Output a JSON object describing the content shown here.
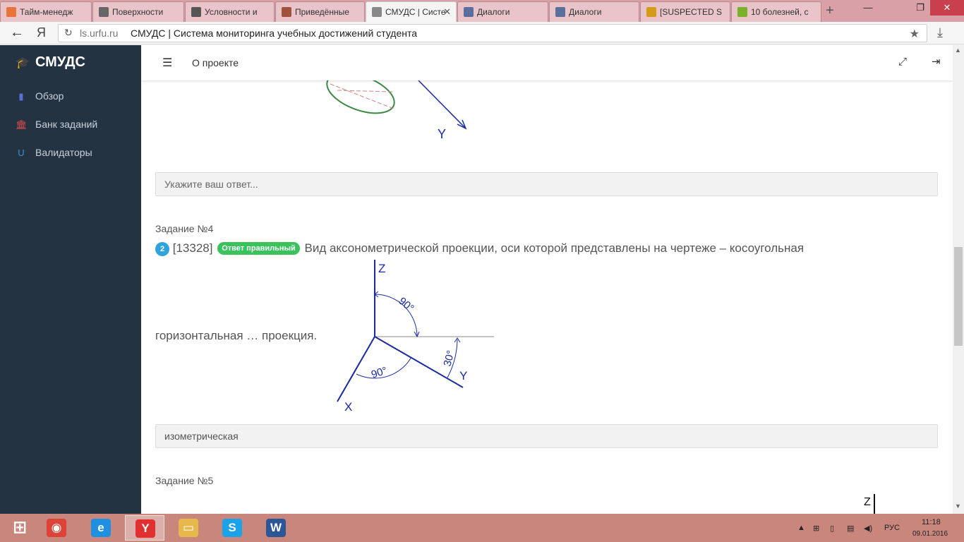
{
  "browser": {
    "tabs": [
      {
        "label": "Тайм-менедж",
        "color": "#e8743b"
      },
      {
        "label": "Поверхности",
        "color": "#666666"
      },
      {
        "label": "Условности и",
        "color": "#555555"
      },
      {
        "label": "Приведённые",
        "color": "#a0523d"
      },
      {
        "label": "СМУДС | Систе",
        "color": "#888888",
        "active": true
      },
      {
        "label": "Диалоги",
        "color": "#5a6f9c"
      },
      {
        "label": "Диалоги",
        "color": "#5a6f9c"
      },
      {
        "label": "[SUSPECTED S",
        "color": "#d49a1a"
      },
      {
        "label": "10 болезней, с",
        "color": "#7bb02a"
      }
    ],
    "new_tab": "+",
    "win_min": "—",
    "win_max": "❐",
    "win_close": "✕",
    "back": "←",
    "yandex": "Я",
    "refresh": "↻",
    "url_host": "ls.urfu.ru",
    "url_title": "СМУДС | Система мониторинга учебных достижений студента",
    "star": "★",
    "download": "⤓"
  },
  "sidebar": {
    "brand": "СМУДС",
    "brand_icon": "🎓",
    "items": [
      {
        "label": "Обзор",
        "icon": "▮",
        "icon_name": "chart-icon",
        "color": "#5b6fd6"
      },
      {
        "label": "Банк заданий",
        "icon": "🏛",
        "icon_name": "bank-icon",
        "color": "#e04b4b"
      },
      {
        "label": "Валидаторы",
        "icon": "U",
        "icon_name": "magnet-icon",
        "color": "#3d8de0"
      }
    ]
  },
  "topbar": {
    "menu_icon": "☰",
    "about": "О проекте",
    "expand_icon": "⤢",
    "exit_icon": "⇥"
  },
  "figure_top": {
    "label_y": "Y"
  },
  "answer1": {
    "placeholder": "Укажите ваш ответ..."
  },
  "task4": {
    "title": "Задание №4",
    "number_badge": "2",
    "id": "[13328]",
    "status_badge": "Ответ правильный",
    "question_part1": "Вид аксонометрической проекции, оси которой представлены на чертеже – косоугольная",
    "question_part2": "горизонтальная … проекция.",
    "figure": {
      "axis_z": "Z",
      "axis_x": "X",
      "axis_y": "Y",
      "angle_zy": "90°",
      "angle_xy": "90°",
      "angle_y": "30°"
    },
    "answer": "изометрическая"
  },
  "task5": {
    "title": "Задание №5",
    "figure": {
      "axis_z": "Z"
    }
  },
  "taskbar": {
    "apps": [
      {
        "name": "windows-start",
        "glyph": "⊞"
      },
      {
        "name": "chrome",
        "glyph": "◉"
      },
      {
        "name": "internet-explorer",
        "glyph": "e"
      },
      {
        "name": "yandex-browser",
        "glyph": "Y",
        "active": true
      },
      {
        "name": "file-explorer",
        "glyph": "▭"
      },
      {
        "name": "skype",
        "glyph": "S"
      },
      {
        "name": "word",
        "glyph": "W"
      }
    ],
    "tray_arrow": "▲",
    "lang": "РУС",
    "time": "11:18",
    "date": "09.01.2016"
  }
}
